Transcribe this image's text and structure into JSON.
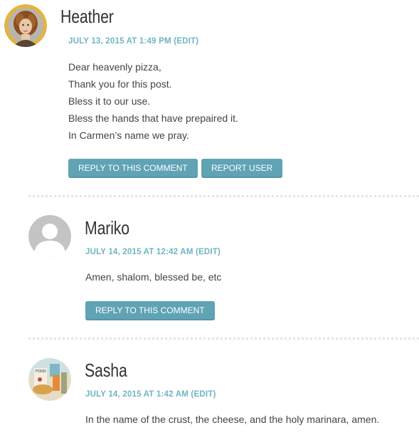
{
  "comments": [
    {
      "author": "Heather",
      "date": "JULY 13, 2015 AT 1:49 PM",
      "edit_label": "(EDIT)",
      "avatar_icon": "heather-avatar-photo",
      "body": [
        "Dear heavenly pizza,",
        "Thank you for this post.",
        "Bless it to our use.",
        "Bless the hands that have prepaired it.",
        "In Carmen’s name we pray."
      ],
      "reply_label": "REPLY TO THIS COMMENT",
      "report_label": "REPORT USER"
    },
    {
      "author": "Mariko",
      "date": "JULY 14, 2015 AT 12:42 AM",
      "edit_label": "(EDIT)",
      "avatar_icon": "default-user-avatar",
      "body": [
        "Amen, shalom, blessed be, etc"
      ],
      "reply_label": "REPLY TO THIS COMMENT"
    },
    {
      "author": "Sasha",
      "date": "JULY 14, 2015 AT 1:42 AM",
      "edit_label": "(EDIT)",
      "avatar_icon": "sasha-avatar-photo",
      "body": [
        "In the name of the crust, the cheese, and the holy marinara, amen."
      ]
    }
  ],
  "colors": {
    "accent": "#6fb5c4",
    "button": "#5fa3b5",
    "heather_avatar_ring": "#e8b33a",
    "divider": "#e4e4e4"
  }
}
